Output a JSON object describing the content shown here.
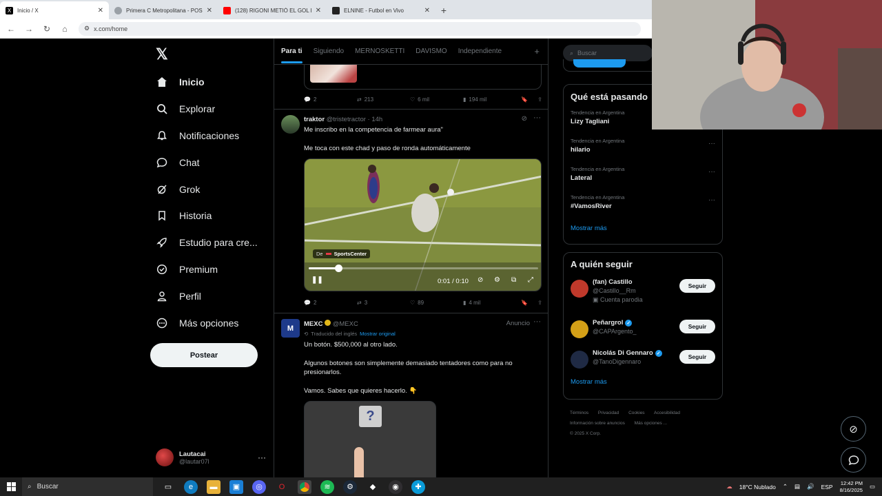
{
  "browser": {
    "tabs": [
      {
        "title": "Inicio / X",
        "favicon_color": "#000000",
        "active": true
      },
      {
        "title": "Primera C Metropolitana - POS...",
        "favicon_color": "#5f6368",
        "active": false
      },
      {
        "title": "(128) RIGONI METIÓ EL GOL D...",
        "favicon_color": "#ff0000",
        "active": false
      },
      {
        "title": "ELNINE - Futbol en Vivo",
        "favicon_color": "#222222",
        "active": false
      }
    ],
    "url": "x.com/home"
  },
  "nav": {
    "items": [
      {
        "label": "Inicio",
        "icon": "home-icon"
      },
      {
        "label": "Explorar",
        "icon": "search-icon"
      },
      {
        "label": "Notificaciones",
        "icon": "bell-icon"
      },
      {
        "label": "Chat",
        "icon": "chat-icon"
      },
      {
        "label": "Grok",
        "icon": "grok-icon"
      },
      {
        "label": "Historia",
        "icon": "bookmark-icon"
      },
      {
        "label": "Estudio para cre...",
        "icon": "rocket-icon"
      },
      {
        "label": "Premium",
        "icon": "verified-icon"
      },
      {
        "label": "Perfil",
        "icon": "person-icon"
      },
      {
        "label": "Más opciones",
        "icon": "more-circle-icon"
      }
    ],
    "post_label": "Postear",
    "account": {
      "name": "Lautacai",
      "handle": "@lautar07l"
    }
  },
  "feed": {
    "tabs": [
      "Para ti",
      "Siguiendo",
      "MERNOSKETTI",
      "DAVISMO",
      "Independiente"
    ],
    "prev_actions": {
      "replies": "2",
      "reposts": "213",
      "likes": "6 mil",
      "views": "194 mil"
    },
    "tweet1": {
      "name": "traktor",
      "handle": "@tristetractor",
      "time": "14h",
      "text1": "Me inscribo en la competencia de farmear aura\"",
      "text2": "Me toca con este chad y paso de ronda automáticamente",
      "video": {
        "source_prefix": "De",
        "source": "SportsCenter",
        "time": "0:01 / 0:10",
        "progress": 0.13
      },
      "actions": {
        "replies": "2",
        "reposts": "3",
        "likes": "89",
        "views": "4 mil"
      }
    },
    "tweet2": {
      "name": "MEXC",
      "handle": "@MEXC",
      "badge": "Anuncio",
      "translated": "Traducido del inglés",
      "show_original": "Mostrar original",
      "text1": "Un botón. $500,000 al otro lado.",
      "text2": "Algunos botones son simplemente demasiado tentadores como para no presionarlos.",
      "text3": "Vamos. Sabes que quieres hacerlo. 👇",
      "image_glyph": "?"
    }
  },
  "sidebar": {
    "search_placeholder": "Buscar",
    "trends_title": "Qué está pasando",
    "trends": [
      {
        "context": "Tendencia en Argentina",
        "name": "Lizy Tagliani"
      },
      {
        "context": "Tendencia en Argentina",
        "name": "hilario"
      },
      {
        "context": "Tendencia en Argentina",
        "name": "Lateral"
      },
      {
        "context": "Tendencia en Argentina",
        "name": "#VamosRiver"
      }
    ],
    "show_more": "Mostrar más",
    "follow_title": "A quién seguir",
    "follow": [
      {
        "name": "(fan) Castillo",
        "handle": "@Castillo__Rm",
        "extra": "Cuenta parodia",
        "verified": false,
        "avatar": "#c0392b"
      },
      {
        "name": "Peñargrol",
        "handle": "@CAPArgento_",
        "extra": "",
        "verified": true,
        "avatar": "#d4a017"
      },
      {
        "name": "Nicolás Di Gennaro",
        "handle": "@TanoDigennaro",
        "extra": "",
        "verified": true,
        "avatar": "#1f2a44"
      }
    ],
    "follow_btn": "Seguir",
    "footer": [
      "Términos",
      "Privacidad",
      "Cookies",
      "Accesibilidad",
      "Información sobre anuncios",
      "Más opciones ...",
      "© 2025 X Corp."
    ]
  },
  "taskbar": {
    "search": "Buscar",
    "weather": "18°C  Nublado",
    "lang": "ESP",
    "time": "12:42 PM",
    "date": "8/16/2025"
  },
  "colors": {
    "accent": "#1d9bf0",
    "bg": "#000000",
    "border": "#2f3336"
  }
}
